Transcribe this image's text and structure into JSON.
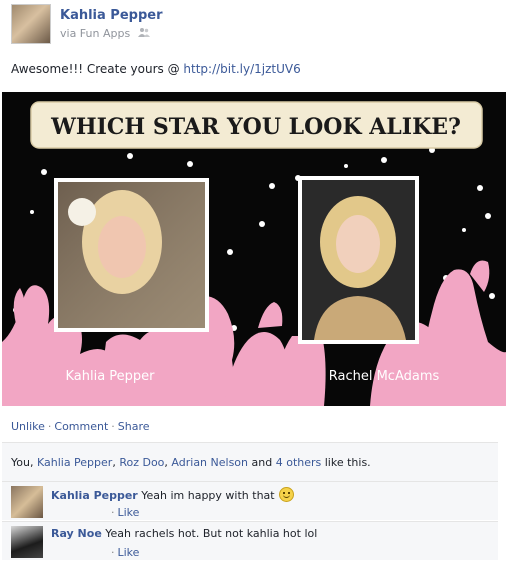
{
  "post": {
    "author": "Kahlia Pepper",
    "via": "via Fun Apps",
    "audience_icon": "people-icon",
    "text_prefix": "Awesome!!! Create yours @",
    "link": "http://bit.ly/1jztUV6"
  },
  "media": {
    "title": "WHICH STAR YOU LOOK ALIKE?",
    "left_caption": "Kahlia Pepper",
    "right_caption": "Rachel McAdams",
    "colors": {
      "background": "#070707",
      "silhouettes": "#f2a6c4",
      "banner": "#f3ebd3",
      "title": "#1a1a1a"
    }
  },
  "actions": {
    "unlike": "Unlike",
    "comment": "Comment",
    "share": "Share",
    "separator": "·"
  },
  "likes": {
    "prefix": "You,",
    "names": [
      "Kahlia Pepper",
      "Roz Doo",
      "Adrian Nelson"
    ],
    "and": "and",
    "others": "4 others",
    "suffix": "like this."
  },
  "comments": [
    {
      "name": "Kahlia Pepper",
      "text": "Yeah im happy with that",
      "emoji": "smiley-icon",
      "like": "Like"
    },
    {
      "name": "Ray Noe",
      "text": "Yeah rachels hot. But not kahlia hot lol",
      "like": "Like"
    }
  ]
}
